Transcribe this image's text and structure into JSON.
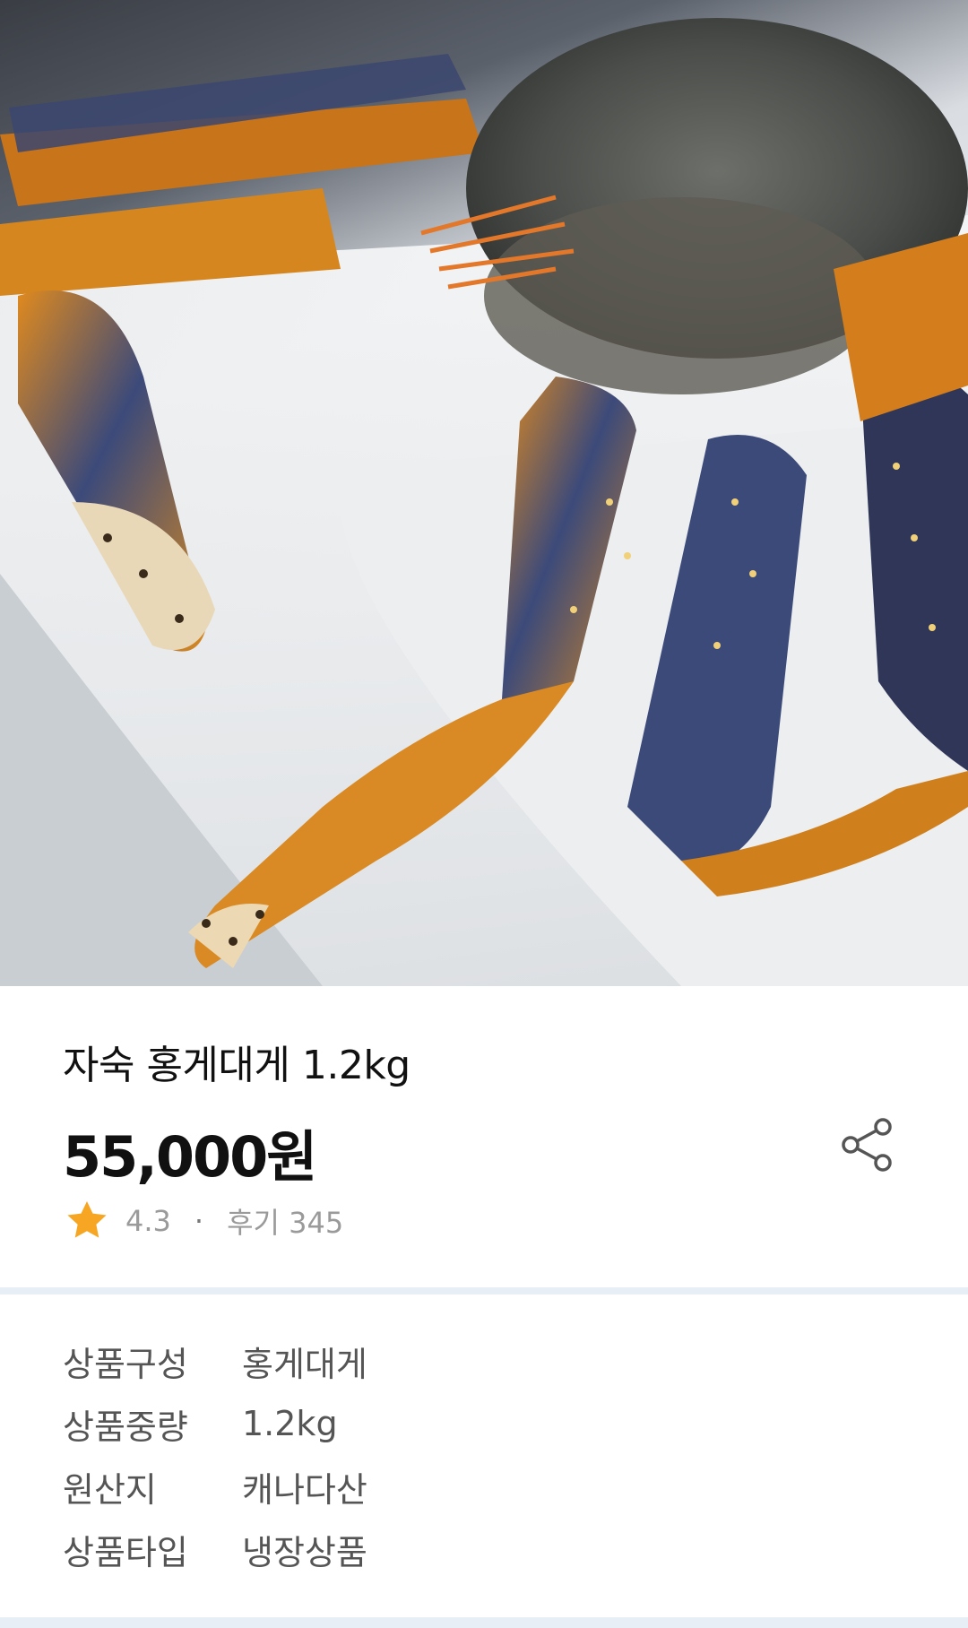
{
  "product": {
    "title": "자숙 홍게대게 1.2kg",
    "price": "55,000원",
    "rating": "4.3",
    "separator": "·",
    "review_label": "후기 345"
  },
  "icons": {
    "share": "share-icon",
    "star": "star-icon"
  },
  "colors": {
    "star": "#F6A623",
    "divider": "#E8EEF5",
    "muted_text": "#9A9A9A"
  },
  "specs": [
    {
      "label": "상품구성",
      "value": "홍게대게"
    },
    {
      "label": "상품중량",
      "value": "1.2kg"
    },
    {
      "label": "원산지",
      "value": "캐나다산"
    },
    {
      "label": "상품타입",
      "value": "냉장상품"
    }
  ]
}
